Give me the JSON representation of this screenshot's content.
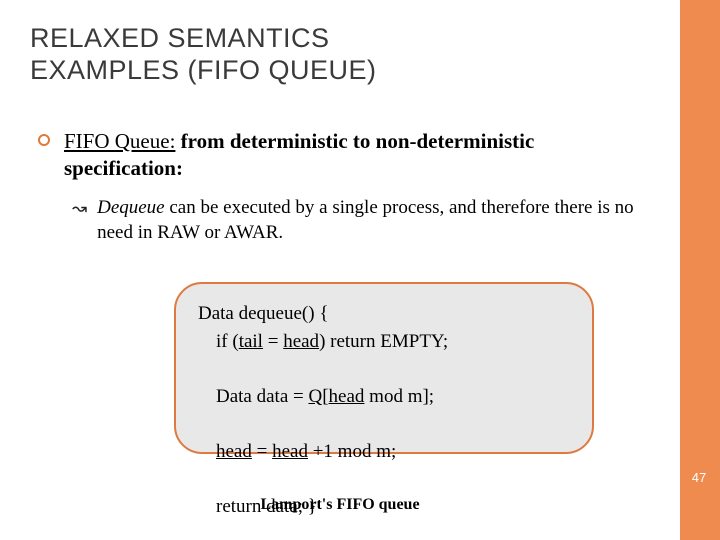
{
  "title": "RELAXED SEMANTICS\nEXAMPLES (FIFO QUEUE)",
  "bullet1_lead": "FIFO Queue:",
  "bullet1_rest": " from deterministic to non-deterministic specification:",
  "bullet2_lead": "Dequeue",
  "bullet2_rest": " can be executed by a single process, and therefore there is no need in RAW or AWAR.",
  "code": {
    "l1": "Data dequeue() {",
    "l2_pre": "if (",
    "l2_u1": "tail",
    "l2_mid": " = ",
    "l2_u2": "head",
    "l2_post": ") return EMPTY;",
    "l3_pre": "Data data = ",
    "l3_u": "Q",
    "l3_mid": "[",
    "l3_u2": "head",
    "l3_post": " mod m];",
    "l4_u1": "head",
    "l4_mid": " = ",
    "l4_u2": "head",
    "l4_post": " +1 mod m;",
    "l5": "return data; }"
  },
  "caption": "Lamport's FIFO queue",
  "page": "47"
}
